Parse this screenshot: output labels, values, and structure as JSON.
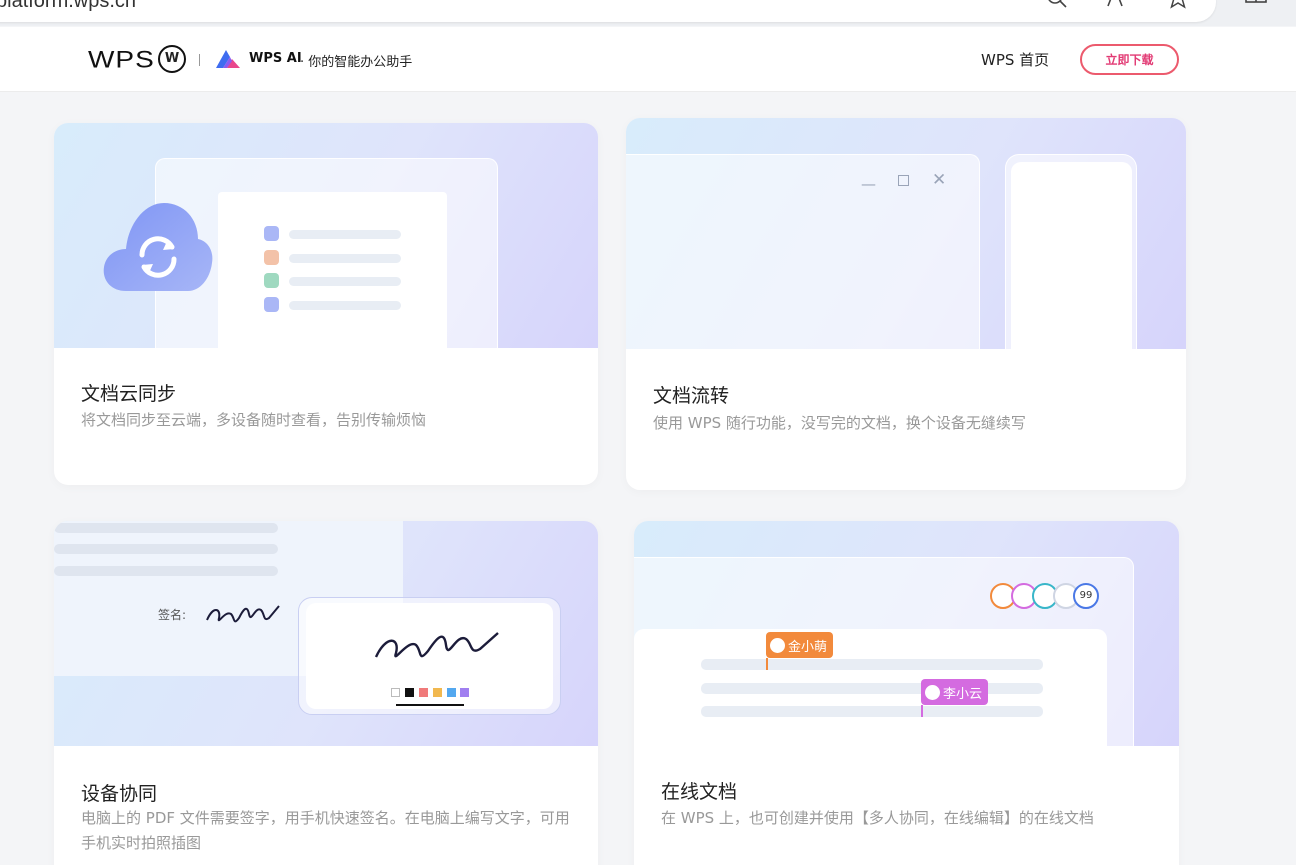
{
  "browser": {
    "url": "platform.wps.cn",
    "icons": [
      "search-icon",
      "read-aloud-icon",
      "favorite-star-icon",
      "split-screen-icon"
    ]
  },
  "header": {
    "logo_text": "WPS",
    "logo_badge": "W",
    "ai_name": "WPS AI",
    "ai_tagline": "· 你的智能办公助手",
    "nav_home": "WPS 首页",
    "download_button": "立即下载"
  },
  "cards": [
    {
      "title": "文档云同步",
      "desc": "将文档同步至云端，多设备随时查看，告别传输烦恼"
    },
    {
      "title": "文档流转",
      "desc": "使用 WPS 随行功能，没写完的文档，换个设备无缝续写"
    },
    {
      "title": "设备协同",
      "desc": "电脑上的 PDF 文件需要签字，用手机快速签名。在电脑上编写文字，可用手机实时拍照插图",
      "sign_label": "签名:"
    },
    {
      "title": "在线文档",
      "desc": "在 WPS 上，也可创建并使用【多人协同，在线编辑】的在线文档",
      "collaborator_count": "99",
      "collaborators": [
        "金小萌",
        "李小云"
      ]
    }
  ],
  "colors": {
    "download_border": "#ec5a6d",
    "download_text": "#e23a74",
    "tag_orange": "#f28a3c",
    "tag_purple": "#d46be0"
  }
}
